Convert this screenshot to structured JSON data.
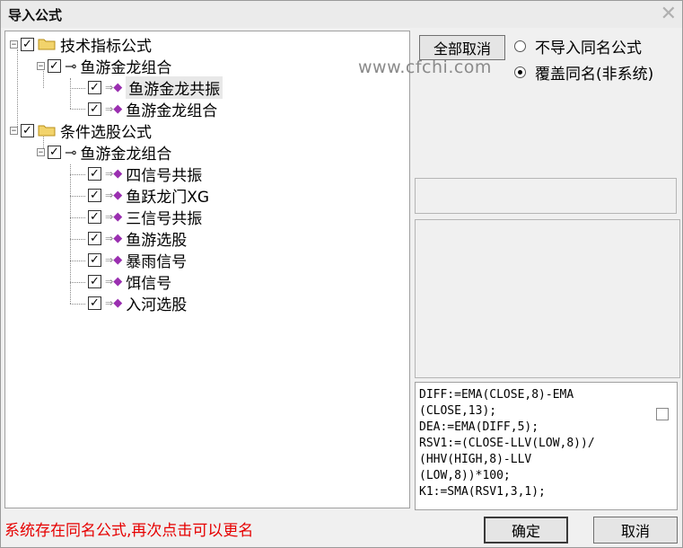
{
  "window": {
    "title": "导入公式",
    "close_icon": "close-icon"
  },
  "tree": {
    "groups": [
      {
        "label": "技术指标公式",
        "checked": true,
        "formula_set": {
          "label": "鱼游金龙组合",
          "items": [
            {
              "label": "鱼游金龙共振",
              "selected": true
            },
            {
              "label": "鱼游金龙组合",
              "selected": false
            }
          ]
        }
      },
      {
        "label": "条件选股公式",
        "checked": true,
        "formula_set": {
          "label": "鱼游金龙组合",
          "items": [
            {
              "label": "四信号共振"
            },
            {
              "label": "鱼跃龙门XG"
            },
            {
              "label": "三信号共振"
            },
            {
              "label": "鱼游选股"
            },
            {
              "label": "暴雨信号"
            },
            {
              "label": "饵信号"
            },
            {
              "label": "入河选股"
            }
          ]
        }
      }
    ]
  },
  "buttons": {
    "deselect_all": "全部取消",
    "ok": "确定",
    "cancel": "取消"
  },
  "options": {
    "no_import_same": "不导入同名公式",
    "overwrite_same": "覆盖同名(非系统)",
    "selected": "overwrite_same"
  },
  "watermark": "www.cfchi.com",
  "code_lines": [
    "DIFF:=EMA(CLOSE,8)-EMA",
    "(CLOSE,13);",
    "DEA:=EMA(DIFF,5);",
    "RSV1:=(CLOSE-LLV(LOW,8))/",
    "(HHV(HIGH,8)-LLV",
    "(LOW,8))*100;",
    "K1:=SMA(RSV1,3,1);"
  ],
  "status_message": "系统存在同名公式,再次点击可以更名",
  "colors": {
    "status": "#e60000",
    "gem": "#9a2fb0",
    "folder": "#f2d36b"
  }
}
